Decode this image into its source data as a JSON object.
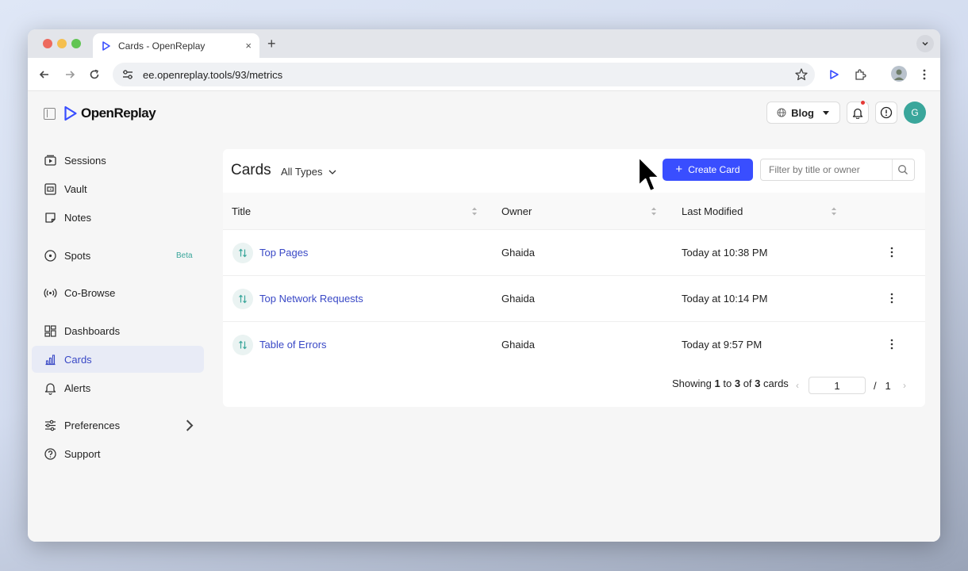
{
  "browser": {
    "tab_title": "Cards - OpenReplay",
    "tab_close": "×",
    "new_tab": "+",
    "url": "ee.openreplay.tools/93/metrics"
  },
  "colors": {
    "accent": "#394eff",
    "link": "#3948c6",
    "avatar_bg": "#3aa69b",
    "sidebar_active_bg": "#e8ebf6"
  },
  "header": {
    "logo_text": "OpenReplay",
    "blog_label": "Blog",
    "avatar_initial": "G"
  },
  "sidebar": {
    "items": [
      {
        "label": "Sessions",
        "icon": "play-box-icon"
      },
      {
        "label": "Vault",
        "icon": "vault-icon"
      },
      {
        "label": "Notes",
        "icon": "notes-icon"
      },
      {
        "label": "Spots",
        "icon": "spot-icon",
        "badge": "Beta"
      },
      {
        "label": "Co-Browse",
        "icon": "broadcast-icon"
      },
      {
        "label": "Dashboards",
        "icon": "grid-icon"
      },
      {
        "label": "Cards",
        "icon": "bar-chart-icon",
        "active": true
      },
      {
        "label": "Alerts",
        "icon": "bell-icon"
      },
      {
        "label": "Preferences",
        "icon": "sliders-icon"
      },
      {
        "label": "Support",
        "icon": "question-icon"
      }
    ]
  },
  "main": {
    "title": "Cards",
    "type_filter": "All Types",
    "create_label": "Create Card",
    "filter_placeholder": "Filter by title or owner",
    "columns": [
      "Title",
      "Owner",
      "Last Modified"
    ],
    "rows": [
      {
        "title": "Top Pages",
        "owner": "Ghaida",
        "modified": "Today at 10:38 PM"
      },
      {
        "title": "Top Network Requests",
        "owner": "Ghaida",
        "modified": "Today at 10:14 PM"
      },
      {
        "title": "Table of Errors",
        "owner": "Ghaida",
        "modified": "Today at 9:57 PM"
      }
    ],
    "pagination": {
      "showing": "Showing",
      "from": "1",
      "to_word": "to",
      "to": "3",
      "of_word": "of",
      "total": "3",
      "unit": "cards",
      "page": "1",
      "page_separator": "/",
      "page_total": "1",
      "prev": "‹",
      "next": "›"
    }
  }
}
